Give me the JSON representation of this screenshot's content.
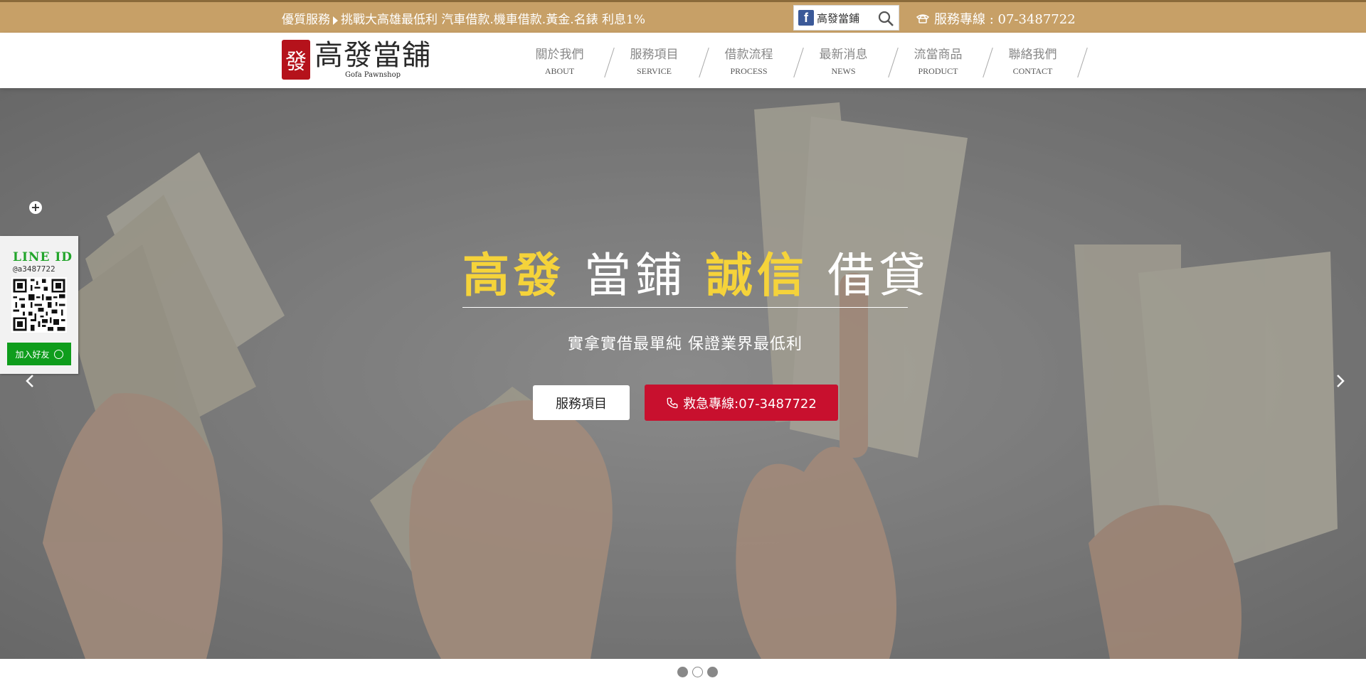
{
  "topbar": {
    "promo_prefix": "優質服務",
    "promo_text": "挑戰大高雄最低利 汽車借款.機車借款.黃金.名錶 利息1%",
    "facebook_label": "高發當鋪",
    "phone_label": "服務專線 : 07-3487722"
  },
  "header": {
    "logo_seal": "發",
    "logo_cn": "高發當舖",
    "logo_en": "Gofa Pawnshop"
  },
  "nav": [
    {
      "cn": "關於我們",
      "en": "ABOUT"
    },
    {
      "cn": "服務項目",
      "en": "SERVICE"
    },
    {
      "cn": "借款流程",
      "en": "PROCESS"
    },
    {
      "cn": "最新消息",
      "en": "NEWS"
    },
    {
      "cn": "流當商品",
      "en": "PRODUCT"
    },
    {
      "cn": "聯絡我們",
      "en": "CONTACT"
    }
  ],
  "hero": {
    "title_1": "高發",
    "title_2": " 當鋪 ",
    "title_3": "誠信",
    "title_4": " 借貸",
    "subtitle": "實拿實借最單純 保證業界最低利",
    "service_button": "服務項目",
    "hotline_button": "救急專線:07-3487722"
  },
  "line_widget": {
    "title": "LINE ID",
    "id": "@a3487722",
    "add_friend": "加入好友"
  },
  "slider": {
    "dot_count": 3,
    "active_dot": 0
  },
  "colors": {
    "topbar_bg": "#c7a067",
    "hero_highlight": "#f5d33a",
    "hotline_red": "#c8102e",
    "line_green": "#0f9d1c"
  }
}
